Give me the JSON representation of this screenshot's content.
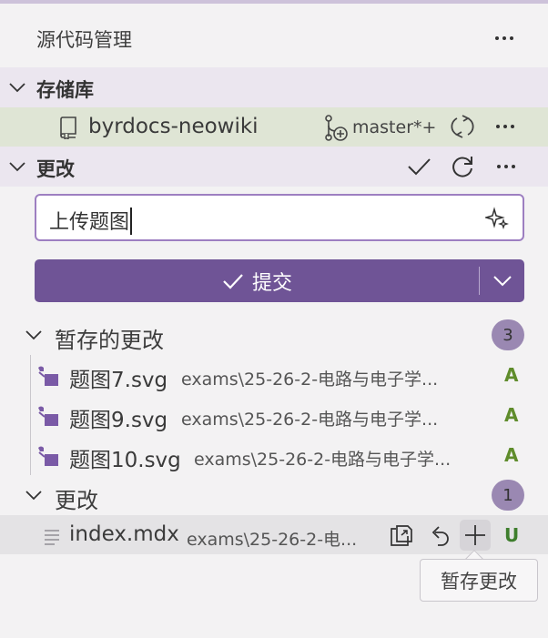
{
  "view": {
    "title": "源代码管理"
  },
  "repositories": {
    "header": "存储库",
    "repo": {
      "name": "byrdocs-neowiki",
      "branch": "master*+"
    }
  },
  "changes_section": {
    "header": "更改",
    "commit_message": "上传题图",
    "commit_button_label": "提交"
  },
  "staged": {
    "label": "暂存的更改",
    "count": "3",
    "files": [
      {
        "name": "题图7.svg",
        "path": "exams\\25-26-2-电路与电子学...",
        "status": "A"
      },
      {
        "name": "题图9.svg",
        "path": "exams\\25-26-2-电路与电子学...",
        "status": "A"
      },
      {
        "name": "题图10.svg",
        "path": "exams\\25-26-2-电路与电子学...",
        "status": "A"
      }
    ]
  },
  "unstaged": {
    "label": "更改",
    "count": "1",
    "files": [
      {
        "name": "index.mdx",
        "path": "exams\\25-26-2-电...",
        "status": "U"
      }
    ]
  },
  "tooltip": {
    "text": "暂存更改"
  },
  "colors": {
    "accent": "#6f5496",
    "input_border": "#9d7fc1",
    "badge": "#9a88b2",
    "added": "#5f8c2b",
    "untracked": "#3e7e2d"
  },
  "icons": [
    "ellipsis-icon",
    "chevron-down-icon",
    "repo-icon",
    "branch-add-icon",
    "sync-icon",
    "check-icon",
    "refresh-icon",
    "sparkle-icon",
    "svg-file-icon",
    "text-file-icon",
    "open-file-icon",
    "discard-icon",
    "plus-icon"
  ]
}
